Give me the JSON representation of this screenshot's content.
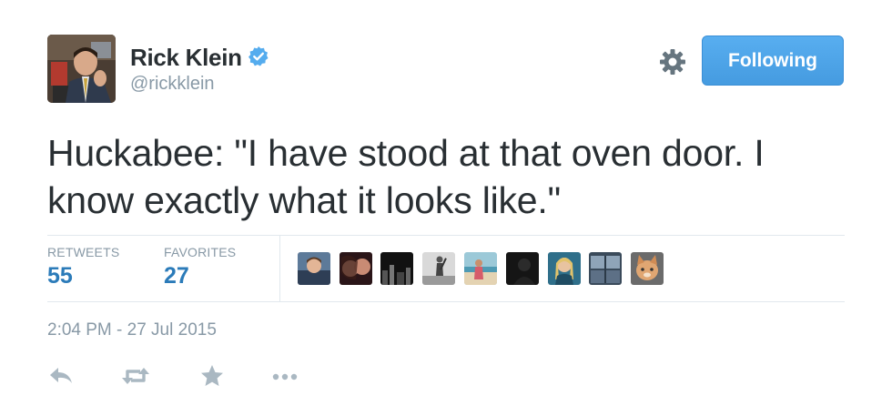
{
  "author": {
    "name": "Rick Klein",
    "handle": "@rickklein",
    "verified": true
  },
  "follow_button": {
    "label": "Following"
  },
  "tweet": {
    "text": "Huckabee: \"I have stood at that oven door. I know exactly what it looks like.\"",
    "timestamp": "2:04 PM - 27 Jul 2015"
  },
  "stats": {
    "retweets_label": "RETWEETS",
    "retweets_count": "55",
    "favorites_label": "FAVORITES",
    "favorites_count": "27"
  },
  "colors": {
    "accent": "#2b7bb9",
    "follow_button": "#55acee",
    "muted": "#8899a6",
    "divider": "#e1e8ed"
  },
  "icons": {
    "gear": "gear-icon",
    "reply": "reply-icon",
    "retweet": "retweet-icon",
    "favorite": "star-icon",
    "more": "more-icon",
    "verified": "verified-badge-icon"
  }
}
